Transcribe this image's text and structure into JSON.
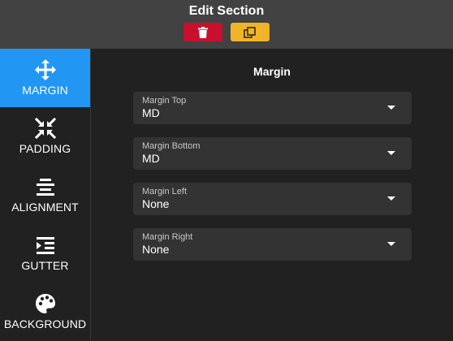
{
  "header": {
    "title": "Edit Section",
    "delete_color": "#c8102e",
    "copy_color": "#f0b429"
  },
  "sidebar": {
    "accent": "#2196f3",
    "items": [
      {
        "label": "MARGIN",
        "icon": "move-arrows-icon",
        "active": true
      },
      {
        "label": "PADDING",
        "icon": "compress-arrows-icon",
        "active": false
      },
      {
        "label": "ALIGNMENT",
        "icon": "align-center-icon",
        "active": false
      },
      {
        "label": "GUTTER",
        "icon": "indent-icon",
        "active": false
      },
      {
        "label": "BACKGROUND",
        "icon": "palette-icon",
        "active": false
      }
    ]
  },
  "main": {
    "title": "Margin",
    "fields": [
      {
        "label": "Margin Top",
        "value": "MD"
      },
      {
        "label": "Margin Bottom",
        "value": "MD"
      },
      {
        "label": "Margin Left",
        "value": "None"
      },
      {
        "label": "Margin Right",
        "value": "None"
      }
    ]
  }
}
